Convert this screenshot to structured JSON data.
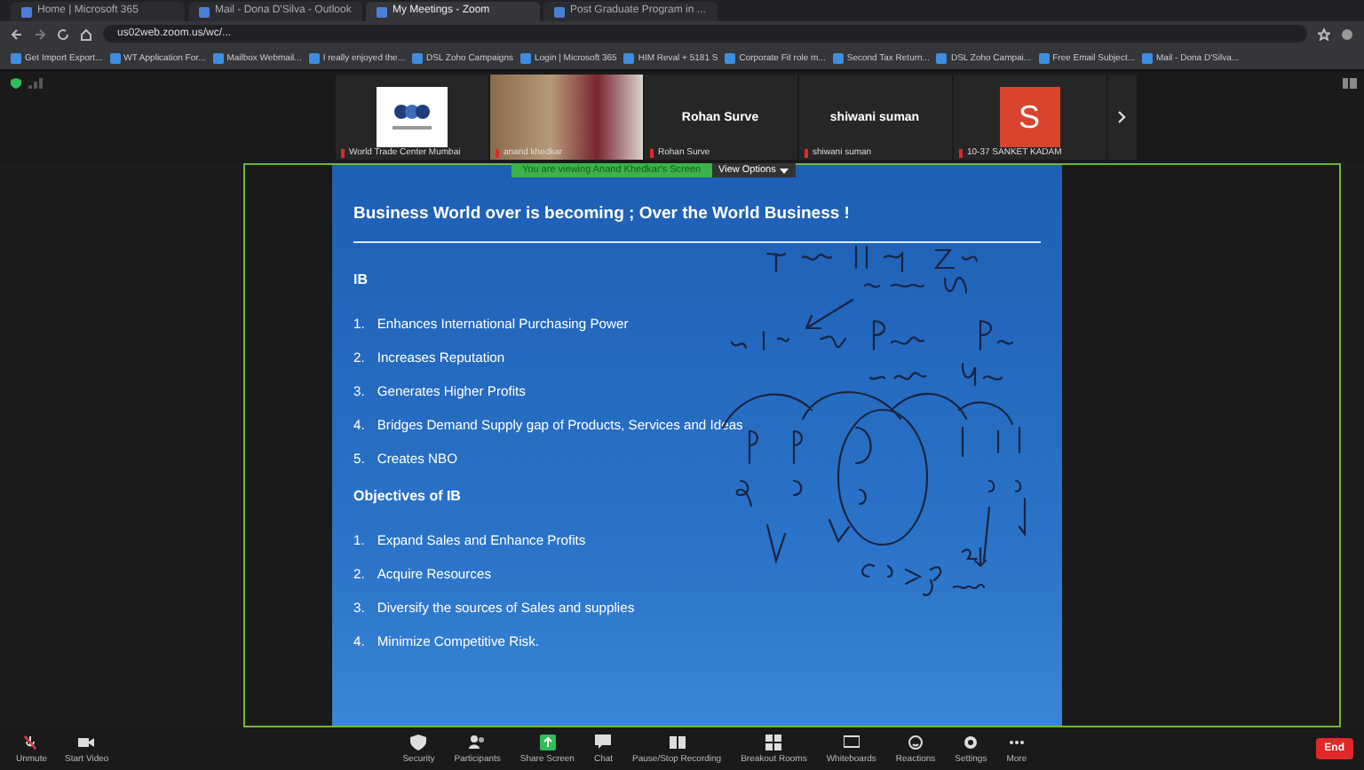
{
  "browser": {
    "tabs": [
      {
        "label": "Home | Microsoft 365",
        "selected": false
      },
      {
        "label": "Mail - Dona D'Silva - Outlook",
        "selected": false
      },
      {
        "label": "My Meetings - Zoom",
        "selected": true
      },
      {
        "label": "Post Graduate Program in ...",
        "selected": false
      }
    ],
    "url": "us02web.zoom.us/wc/...",
    "bookmarks": [
      "Get Import Export...",
      "WT Application For...",
      "Mailbox Webmail...",
      "I really enjoyed the...",
      "DSL Zoho Campaigns",
      "Login | Microsoft 365",
      "HIM Reval + 5181 S",
      "Corporate Fit role m...",
      "Second Tax Return...",
      "DSL Zoho Campai...",
      "Free Email Subject...",
      "Mail - Dona D'Silva..."
    ]
  },
  "participants": [
    {
      "kind": "logo",
      "name": "World Trade Center Mumbai"
    },
    {
      "kind": "video",
      "name": "anand khedkar"
    },
    {
      "kind": "text",
      "name": "Rohan Surve",
      "display": "Rohan Surve"
    },
    {
      "kind": "text",
      "name": "shiwani suman",
      "display": "shiwani suman"
    },
    {
      "kind": "avatar",
      "name": "10-37 SANKET KADAM",
      "initial": "S"
    }
  ],
  "share_banner": {
    "text": "You are viewing Anand Khedkar's Screen",
    "view_options": "View Options"
  },
  "slide": {
    "title": "Business World over is becoming ; Over the World Business !",
    "sections": [
      {
        "heading": "IB",
        "items": [
          {
            "number": "1.",
            "text": "Enhances International Purchasing Power"
          },
          {
            "number": "2.",
            "text": "Increases Reputation"
          },
          {
            "number": "3.",
            "text": "Generates Higher Profits"
          },
          {
            "number": "4.",
            "text": "Bridges Demand Supply gap of Products, Services and Ideas"
          },
          {
            "number": "5.",
            "text": "Creates NBO"
          }
        ]
      },
      {
        "heading": "Objectives of IB",
        "items": [
          {
            "number": "1.",
            "text": "Expand Sales and Enhance Profits"
          },
          {
            "number": "2.",
            "text": "Acquire Resources"
          },
          {
            "number": "3.",
            "text": "Diversify the sources of Sales and supplies"
          },
          {
            "number": "4.",
            "text": "Minimize Competitive Risk."
          }
        ]
      }
    ]
  },
  "toolbar": {
    "left": [
      {
        "kind": "mic",
        "label": "Unmute"
      },
      {
        "kind": "video",
        "label": "Start Video"
      }
    ],
    "center": [
      {
        "kind": "shield",
        "label": "Security"
      },
      {
        "kind": "people",
        "label": "Participants"
      },
      {
        "kind": "share",
        "label": "Share Screen"
      },
      {
        "kind": "chat",
        "label": "Chat"
      },
      {
        "kind": "record",
        "label": "Pause/Stop Recording"
      },
      {
        "kind": "grid",
        "label": "Breakout Rooms"
      },
      {
        "kind": "board",
        "label": "Whiteboards"
      },
      {
        "kind": "react",
        "label": "Reactions"
      },
      {
        "kind": "gear",
        "label": "Settings"
      },
      {
        "kind": "more",
        "label": "More"
      }
    ],
    "end": "End"
  }
}
